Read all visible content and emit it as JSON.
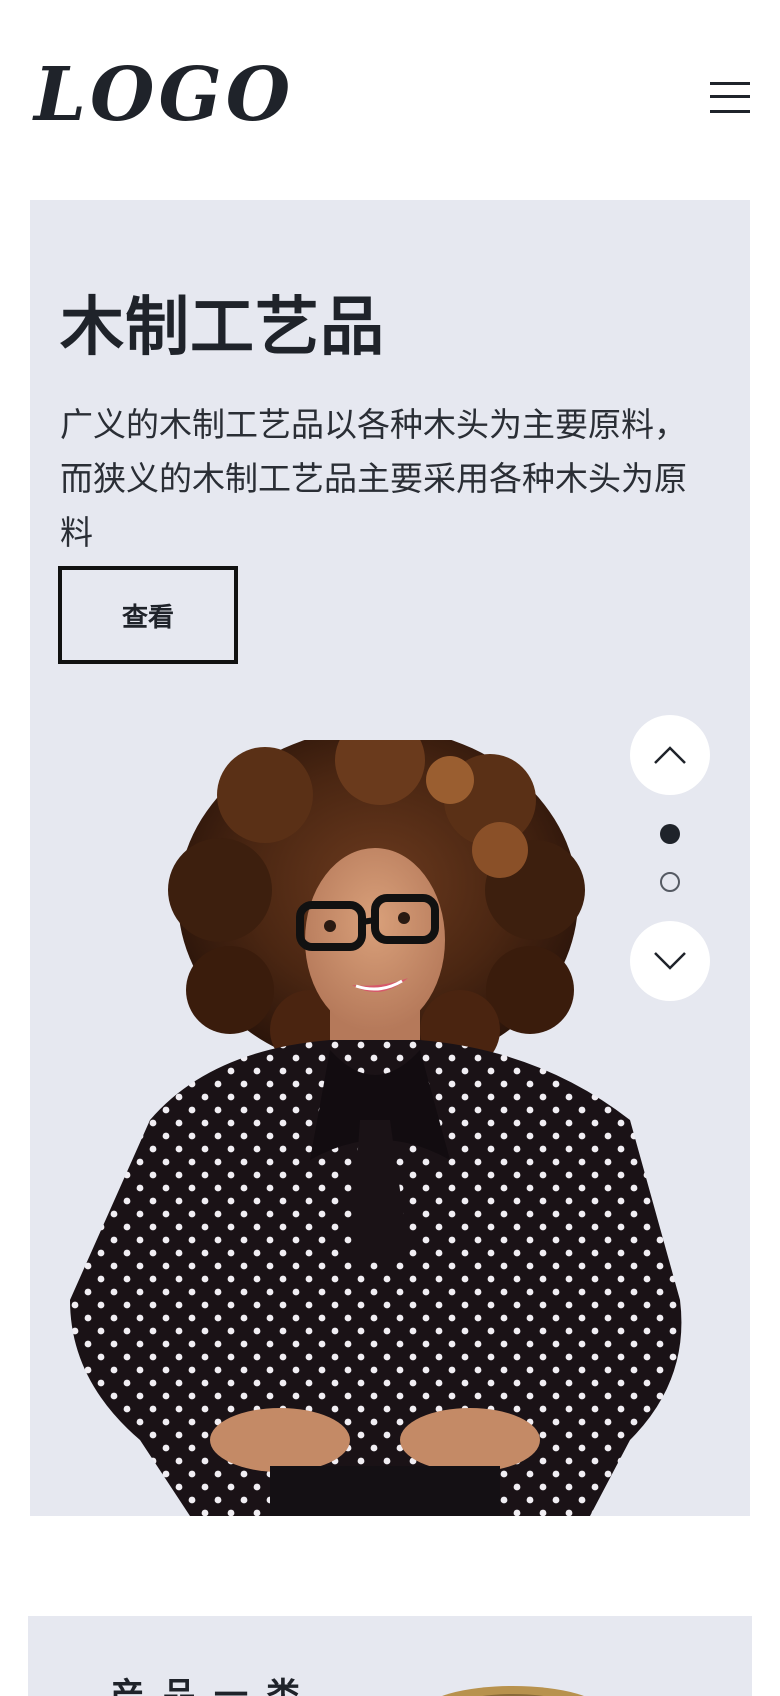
{
  "header": {
    "logo_text": "LOGO",
    "menu_icon": "hamburger-menu-icon"
  },
  "hero": {
    "title": "木制工艺品",
    "description": "广义的木制工艺品以各种木头为主要原料，而狭义的木制工艺品主要采用各种木头为原料",
    "button_label": "查看",
    "slider": {
      "prev_icon": "chevron-up-icon",
      "next_icon": "chevron-down-icon",
      "dots": 2,
      "active_index": 0
    }
  },
  "section2": {
    "title": "产品一类"
  },
  "colors": {
    "background": "#ffffff",
    "hero_background": "#e6e8f0",
    "text": "#1f232a",
    "accent_dark": "#111111"
  }
}
